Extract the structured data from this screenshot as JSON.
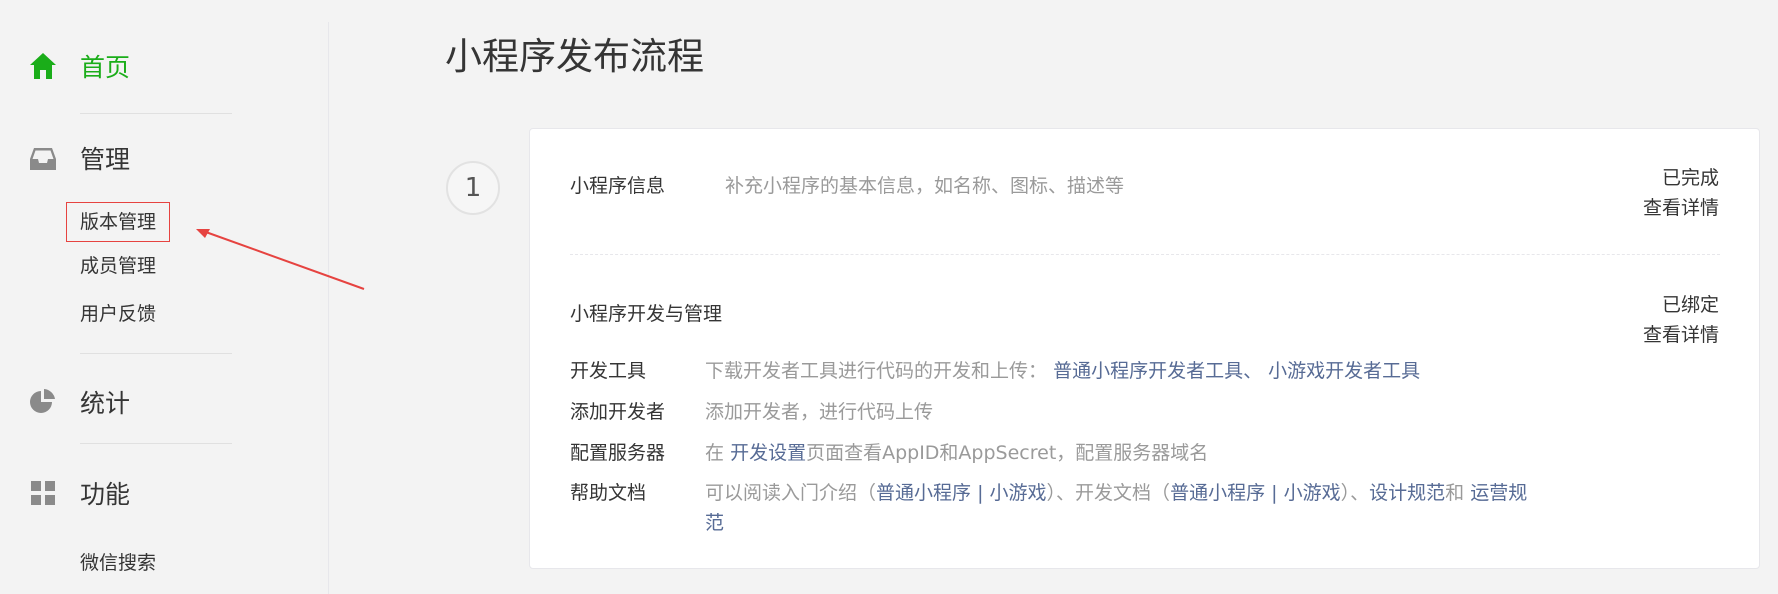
{
  "sidebar": {
    "home": "首页",
    "manage": "管理",
    "manage_items": [
      "版本管理",
      "成员管理",
      "用户反馈"
    ],
    "stats": "统计",
    "features": "功能",
    "features_items": [
      "微信搜索"
    ],
    "icons": [
      "home-icon",
      "inbox-icon",
      "pie-chart-icon",
      "grid-icon"
    ],
    "active_color": "#1aad19"
  },
  "main": {
    "title": "小程序发布流程",
    "step_number": "1",
    "info": {
      "title": "小程序信息",
      "desc": "补充小程序的基本信息，如名称、图标、描述等",
      "status": "已完成",
      "link": "查看详情"
    },
    "dev": {
      "title": "小程序开发与管理",
      "status": "已绑定",
      "link": "查看详情",
      "tools_label": "开发工具",
      "tools_desc": "下载开发者工具进行代码的开发和上传：",
      "tools_link1": "普通小程序开发者工具",
      "tools_sep": "、",
      "tools_link2": "小游戏开发者工具",
      "add_label": "添加开发者",
      "add_desc": "添加开发者，进行代码上传",
      "server_label": "配置服务器",
      "server_pre": "在",
      "server_link": "开发设置",
      "server_post": "页面查看AppID和AppSecret，配置服务器域名",
      "help_label": "帮助文档",
      "help_t1": "可以阅读入门介绍（",
      "help_l1": "普通小程序",
      "help_bar1": "|",
      "help_l2": "小游戏",
      "help_t2": "）、开发文档（",
      "help_l3": "普通小程序",
      "help_bar2": "|",
      "help_l4": "小游戏",
      "help_t3": "）、",
      "help_l5": "设计规范",
      "help_t4": "和",
      "help_l6": "运营规",
      "help_l6b": "范"
    }
  },
  "colors": {
    "link": "#576b95",
    "annotation": "#e64340"
  }
}
